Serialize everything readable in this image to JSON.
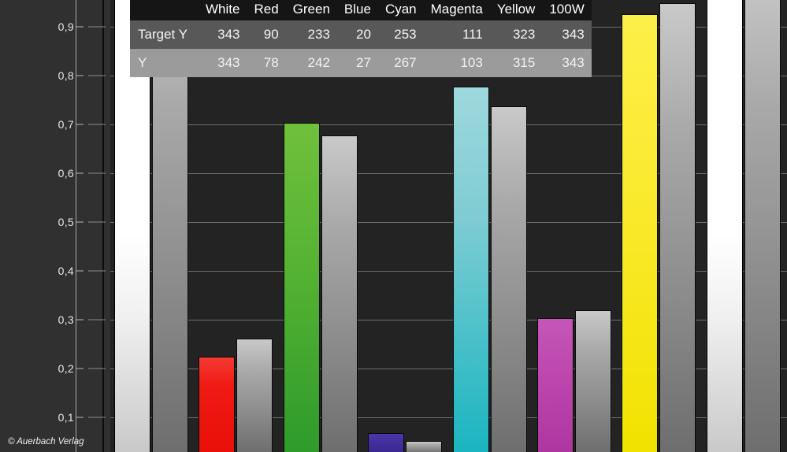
{
  "chart_data": {
    "type": "bar",
    "title": "",
    "xlabel": "",
    "ylabel": "",
    "ylim": [
      0,
      0.96
    ],
    "grid": true,
    "legend_position": "none",
    "categories": [
      "White",
      "Red",
      "Green",
      "Blue",
      "Cyan",
      "Magenta",
      "Yellow",
      "100W"
    ],
    "ytick_labels": [
      "0,9",
      "0,8",
      "0,7",
      "0,6",
      "0,5",
      "0,4",
      "0,3",
      "0,2",
      "0,1"
    ],
    "ytick_values": [
      0.9,
      0.8,
      0.7,
      0.6,
      0.5,
      0.4,
      0.3,
      0.2,
      0.1
    ],
    "series": [
      {
        "name": "Target Y",
        "color_role": "per-category",
        "values": [
          1.02,
          0.225,
          0.703,
          0.068,
          0.778,
          0.303,
          0.926,
          1.02
        ],
        "bar_colors": [
          "white",
          "red",
          "green",
          "blue",
          "cyan",
          "magenta",
          "yellow",
          "white"
        ]
      },
      {
        "name": "Y",
        "color_role": "gray",
        "values": [
          1.02,
          0.261,
          0.677,
          0.051,
          0.737,
          0.32,
          0.948,
          1.02
        ],
        "bar_colors": [
          "gray",
          "gray",
          "gray",
          "gray",
          "gray",
          "gray",
          "gray",
          "gray"
        ]
      }
    ]
  },
  "data_table": {
    "corner_label": "",
    "columns": [
      "White",
      "Red",
      "Green",
      "Blue",
      "Cyan",
      "Magenta",
      "Yellow",
      "100W"
    ],
    "rows": [
      {
        "label": "Target Y",
        "values": [
          "343",
          "90",
          "233",
          "20",
          "253",
          "111",
          "323",
          "343"
        ]
      },
      {
        "label": "Y",
        "values": [
          "343",
          "78",
          "242",
          "27",
          "267",
          "103",
          "315",
          "343"
        ]
      }
    ]
  },
  "footer": {
    "copyright": "© Auerbach Verlag"
  },
  "colors": {
    "plot_background": "#232323",
    "axis_background": "#303030",
    "gridline": "#707070",
    "white_bar": "#ffffff",
    "red_bar": "#ee1111",
    "green_bar": "#55b233",
    "blue_bar": "#422f9c",
    "cyan_bar": "#7fccd3",
    "magenta_bar": "#bc46ad",
    "yellow_bar": "#f9e92c",
    "gray_bar": "#a0a0a0",
    "tick_text": "#e8e8e8"
  }
}
